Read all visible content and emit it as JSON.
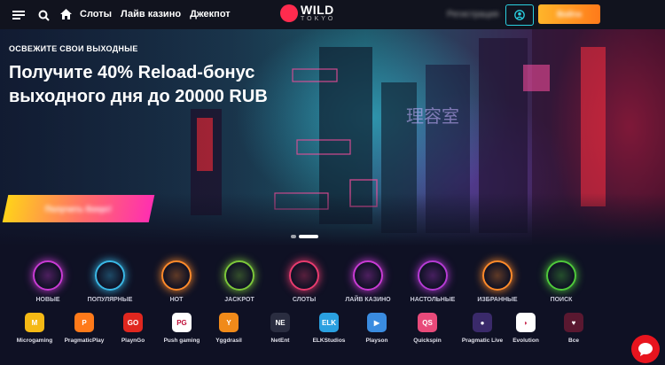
{
  "header": {
    "nav": [
      "Слоты",
      "Лайв казино",
      "Джекпот"
    ],
    "logo": {
      "main": "WILD",
      "sub": "TOKYO"
    },
    "login_label": "Регистрация",
    "deposit_label": "Войти"
  },
  "hero": {
    "subtitle": "ОСВЕЖИТЕ СВОИ ВЫХОДНЫЕ",
    "headline": "Получите 40% Reload-бонус выходного дня до 20000 RUB",
    "cta_label": "Получить бонус!"
  },
  "categories": [
    {
      "label": "НОВЫЕ",
      "icon": "new-badge-icon",
      "color": "#c93bd4"
    },
    {
      "label": "ПОПУЛЯРНЫЕ",
      "icon": "arrow-up-icon",
      "color": "#3ab8e6"
    },
    {
      "label": "HOT",
      "icon": "flame-icon",
      "color": "#ff8a2a"
    },
    {
      "label": "JACKPOT",
      "icon": "jackpot-icon",
      "color": "#7cc73a"
    },
    {
      "label": "СЛОТЫ",
      "icon": "slots-icon",
      "color": "#e83b6e"
    },
    {
      "label": "ЛАЙВ КАЗИНО",
      "icon": "play-icon",
      "color": "#c93bd4"
    },
    {
      "label": "НАСТОЛЬНЫЕ",
      "icon": "table-games-icon",
      "color": "#b53bd4"
    },
    {
      "label": "ИЗБРАННЫЕ",
      "icon": "star-icon",
      "color": "#ff8a2a"
    },
    {
      "label": "ПОИСК",
      "icon": "search-icon",
      "color": "#4fc93b"
    }
  ],
  "providers": [
    {
      "label": "Microgaming",
      "mark": "M",
      "color": "#f5b915"
    },
    {
      "label": "PragmaticPlay",
      "mark": "P",
      "color": "#ff7a1a"
    },
    {
      "label": "PlaynGo",
      "mark": "GO",
      "color": "#e0271f"
    },
    {
      "label": "Push gaming",
      "mark": "PG",
      "color": "#ffffff"
    },
    {
      "label": "Yggdrasil",
      "mark": "Y",
      "color": "#f08a1a"
    },
    {
      "label": "NetEnt",
      "mark": "NE",
      "color": "#2a2d40"
    },
    {
      "label": "ELKStudios",
      "mark": "ELK",
      "color": "#2aa0e0"
    },
    {
      "label": "Playson",
      "mark": "▶",
      "color": "#3a8ce0"
    },
    {
      "label": "Quickspin",
      "mark": "QS",
      "color": "#e84a7a"
    },
    {
      "label": "Pragmatic Live",
      "mark": "●",
      "color": "#3a2a6a"
    },
    {
      "label": "Evolution",
      "mark": "◗",
      "color": "#ffffff"
    },
    {
      "label": "Все",
      "mark": "♥",
      "color": "#5a1830"
    }
  ]
}
